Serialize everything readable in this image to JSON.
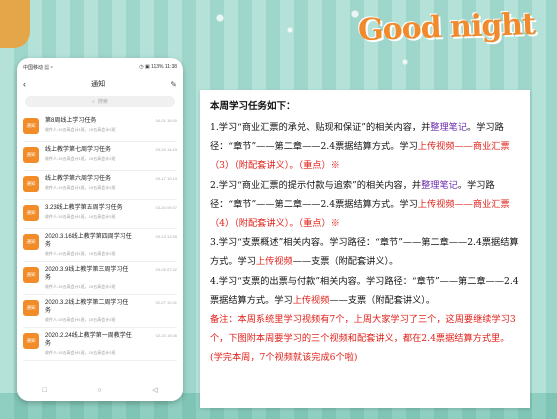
{
  "header": {
    "logo_text": "Good night"
  },
  "phone": {
    "status_left": "中国移动 ▦ ᵒ",
    "status_right": "◷ ▣ 113%  11:38",
    "nav_title": "通知",
    "search_placeholder": "搜索",
    "items": [
      {
        "badge": "通知",
        "title": "第8周线上学习任务",
        "time": "04-01 16:00",
        "sub": "收件人:19五高会计1班，19五高会计2班"
      },
      {
        "badge": "通知",
        "title": "线上教学第七周学习任务",
        "time": "03-24 14:43",
        "sub": "收件人:19五高会计1班，19五高会计2班"
      },
      {
        "badge": "通知",
        "title": "线上教学第六周学习任务",
        "time": "03-17 10:13",
        "sub": "收件人:19五高会计1班，19五高会计2班"
      },
      {
        "badge": "通知",
        "title": "3.23线上教学第五周学习任务",
        "time": "03-20 09:37",
        "sub": "收件人:19五高会计1班，19五高会计2班"
      },
      {
        "badge": "通知",
        "title": "2020.3.16线上教学第四周学习任务",
        "time": "03-13 13:39",
        "sub": "收件人:19五高会计1班，19五高会计2班"
      },
      {
        "badge": "通知",
        "title": "2020.3.9线上教学第三周学习任务",
        "time": "03-06 07:32",
        "sub": "收件人:19五高会计1班，19五高会计2班"
      },
      {
        "badge": "通知",
        "title": "2020.3.2线上教学第二周学习任务",
        "time": "02-27 10:31",
        "sub": "收件人:19五高会计1班，19五高会计2班"
      },
      {
        "badge": "通知",
        "title": "2020.2.24线上教学第一周教学任务",
        "time": "02-20 15:36",
        "sub": "收件人:19五高会计1班，19五高会计2班"
      }
    ],
    "home_buttons": [
      "□",
      "○",
      "◁"
    ]
  },
  "card": {
    "title": "本周学习任务如下：",
    "p1_a": "1.学习“商业汇票的承兑、贴现和保证”的相关内容，并",
    "p1_b": "整理笔记",
    "p1_c": "。学习路径：“章节”——第二章——2.4票据结算方式。学习",
    "p1_d": "上传视频——商业汇票（3）（附配套讲义）。（重点）※",
    "p2_a": "2.学习“商业汇票的提示付款与追索”的相关内容，并",
    "p2_b": "整理笔记",
    "p2_c": "。学习路径：“章节”——第二章——2.4票据结算方式。学习",
    "p2_d": "上传视频——商业汇票（4）（附配套讲义）。（重点）※",
    "p3_a": "3.学习“支票概述”相关内容。学习路径：“章节”——第二章——2.4票据结算方式。学习",
    "p3_b": "上传视频",
    "p3_c": "——支票（附配套讲义）。",
    "p4_a": "4.学习“支票的出票与付款”相关内容。学习路径：“章节”——第二章——2.4票据结算方式。学习",
    "p4_b": "上传视频",
    "p4_c": "——支票（附配套讲义）。",
    "note": "备注：本周系统里学习视频有7个，上周大家学习了三个，这周要继续学习3个，下图附本周要学习的三个视频和配套讲义，都在2.4票据结算方式里。(学完本周，7个视频就该完成6个啦)"
  }
}
